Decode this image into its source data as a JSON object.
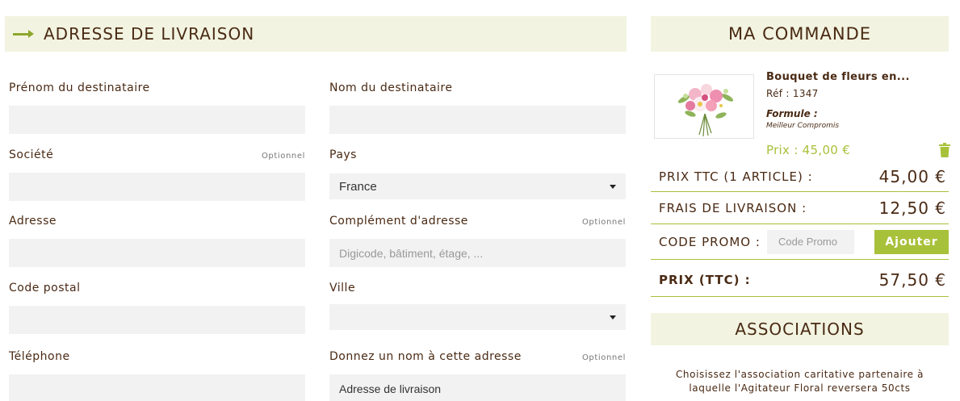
{
  "delivery": {
    "title": "ADRESSE DE LIVRAISON",
    "optional_label": "Optionnel",
    "fields": {
      "first_name": {
        "label": "Prénom du destinataire",
        "value": ""
      },
      "last_name": {
        "label": "Nom du destinataire",
        "value": ""
      },
      "company": {
        "label": "Société",
        "value": ""
      },
      "country": {
        "label": "Pays",
        "value": "France"
      },
      "address": {
        "label": "Adresse",
        "value": ""
      },
      "address_complement": {
        "label": "Complément d'adresse",
        "placeholder": "Digicode, bâtiment, étage, ..."
      },
      "postal_code": {
        "label": "Code postal",
        "value": ""
      },
      "city": {
        "label": "Ville",
        "value": ""
      },
      "phone": {
        "label": "Téléphone",
        "value": ""
      },
      "address_name": {
        "label": "Donnez un nom à cette adresse",
        "value": "Adresse de livraison"
      }
    }
  },
  "order": {
    "title": "MA COMMANDE",
    "product": {
      "name": "Bouquet de fleurs en...",
      "ref": "Réf : 1347",
      "formula_label": "Formule :",
      "formula_value": "Meilleur Compromis",
      "price": "Prix : 45,00 €",
      "image_icon": "flower-bouquet-image"
    },
    "subtotal": {
      "label": "PRIX TTC (1 ARTICLE) :",
      "value": "45,00 €"
    },
    "shipping": {
      "label": "FRAIS DE LIVRAISON :",
      "value": "12,50 €"
    },
    "promo": {
      "label": "CODE PROMO :",
      "placeholder": "Code Promo",
      "button": "Ajouter"
    },
    "total": {
      "label": "PRIX (TTC) :",
      "value": "57,50 €"
    }
  },
  "associations": {
    "title": "ASSOCIATIONS",
    "text": "Choisissez l'association caritative partenaire à laquelle l'Agitateur Floral reversera 50cts"
  },
  "colors": {
    "accent": "#a8c13a",
    "header_bg": "#f2f4e1",
    "text": "#4a2a14",
    "field_bg": "#f2f2f2"
  }
}
